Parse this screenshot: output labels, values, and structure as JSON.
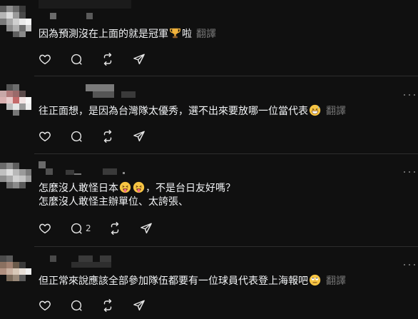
{
  "comments": [
    {
      "text": "因為預測沒在上面的就是冠軍",
      "text_after_emoji": "啦",
      "emoji": "trophy",
      "translate_label": "翻譯",
      "reply_count": ""
    },
    {
      "text": "往正面想，是因為台灣隊太優秀，選不出來要放哪一位當代表",
      "emoji": "grinning-sweat",
      "translate_label": "翻譯",
      "reply_count": ""
    },
    {
      "text": "怎麼沒人敢怪日本",
      "emoji": "tongue-out",
      "text_after_emoji": "，不是台日友好嗎？",
      "line2": "怎麼沒人敢怪主辦單位、太誇張、",
      "reply_count": "2"
    },
    {
      "text": "但正常來說應該全部參加隊伍都要有一位球員代表登上海報吧",
      "emoji": "rolling-eyes",
      "translate_label": "翻譯",
      "reply_count": ""
    }
  ],
  "icons": [
    "heart-icon",
    "comment-icon",
    "repost-icon",
    "share-icon",
    "more-icon"
  ],
  "colors": {
    "background": "#101010",
    "text": "#f3f5f7",
    "muted": "#777777",
    "divider": "#2d2d2d"
  }
}
